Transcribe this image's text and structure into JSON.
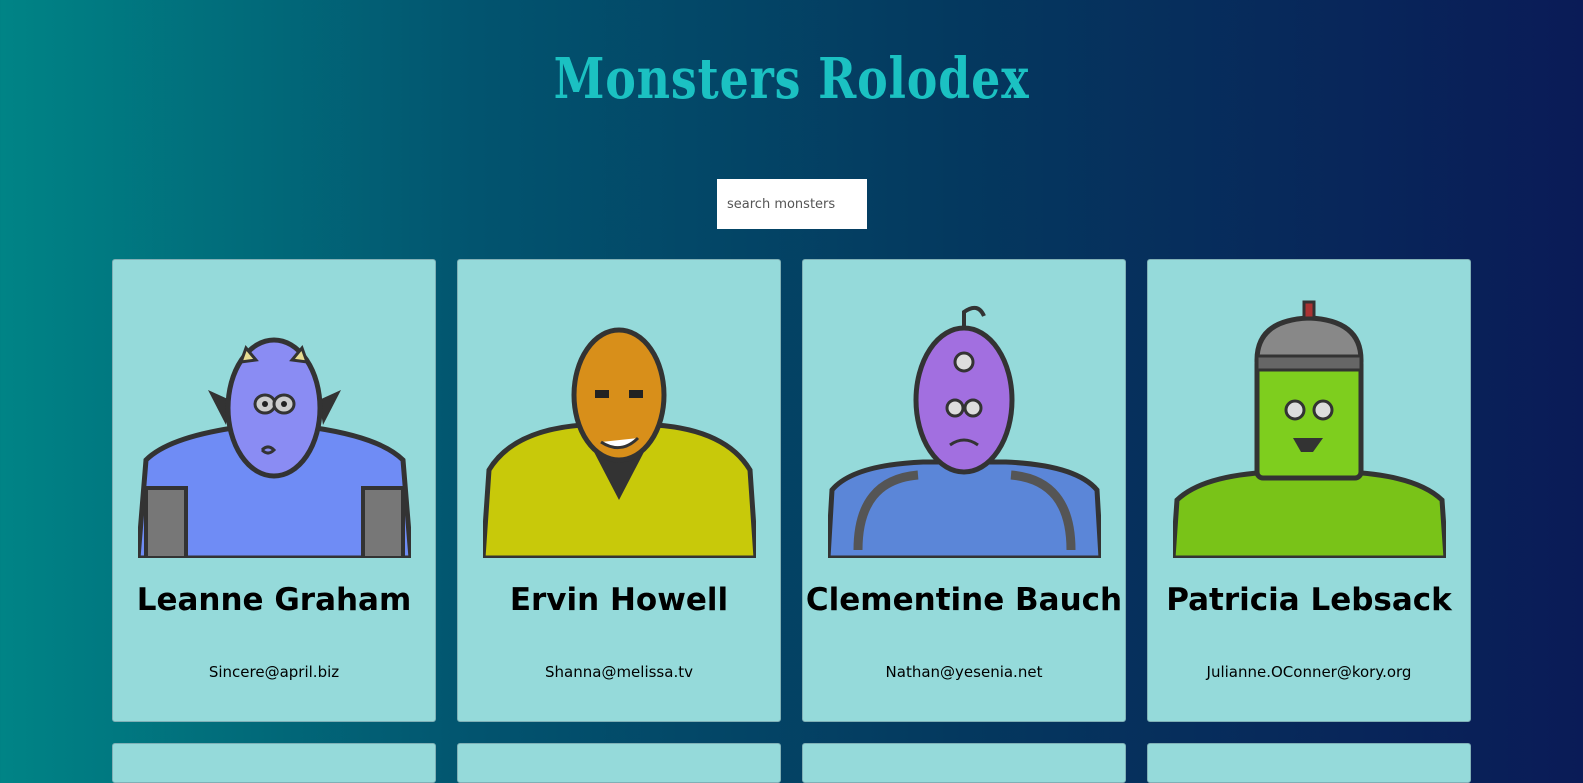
{
  "app": {
    "title": "Monsters Rolodex"
  },
  "search": {
    "placeholder": "search monsters",
    "value": ""
  },
  "monsters": [
    {
      "name": "Leanne Graham",
      "email": "Sincere@april.biz",
      "body_color": "#6f8cf5",
      "head_color": "#8a8cf3"
    },
    {
      "name": "Ervin Howell",
      "email": "Shanna@melissa.tv",
      "body_color": "#c8c90a",
      "head_color": "#d88f1a"
    },
    {
      "name": "Clementine Bauch",
      "email": "Nathan@yesenia.net",
      "body_color": "#5b86d8",
      "head_color": "#a26fe0"
    },
    {
      "name": "Patricia Lebsack",
      "email": "Julianne.OConner@kory.org",
      "body_color": "#79c318",
      "head_color": "#7ece1e"
    }
  ]
}
